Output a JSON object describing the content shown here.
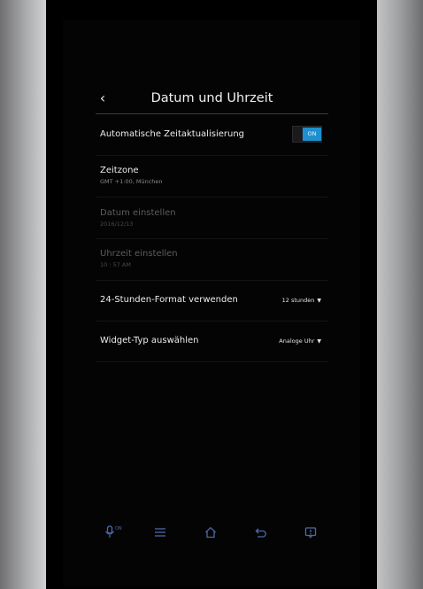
{
  "header": {
    "title": "Datum und Uhrzeit"
  },
  "settings": {
    "auto_update": {
      "label": "Automatische Zeitaktualisierung",
      "toggle_label": "ON"
    },
    "timezone": {
      "label": "Zeitzone",
      "value": "GMT +1:00, München"
    },
    "set_date": {
      "label": "Datum einstellen",
      "value": "2016/12/13"
    },
    "set_time": {
      "label": "Uhrzeit einstellen",
      "value": "10 : 57 AM"
    },
    "format_24h": {
      "label": "24-Stunden-Format verwenden",
      "selected": "12 stunden"
    },
    "widget_type": {
      "label": "Widget-Typ auswählen",
      "selected": "Analoge Uhr"
    }
  },
  "navbar": {
    "mic_status": "ON"
  },
  "icons": {
    "back": "chevron-left-icon",
    "dropdown": "caret-down-icon",
    "mic": "microphone-icon",
    "menu": "menu-icon",
    "home": "home-icon",
    "return": "back-arrow-icon",
    "notifications": "notification-icon"
  },
  "colors": {
    "accent": "#1f8fcf",
    "background": "#040405",
    "text": "#ededed",
    "disabled_text": "#5c5c5e"
  }
}
